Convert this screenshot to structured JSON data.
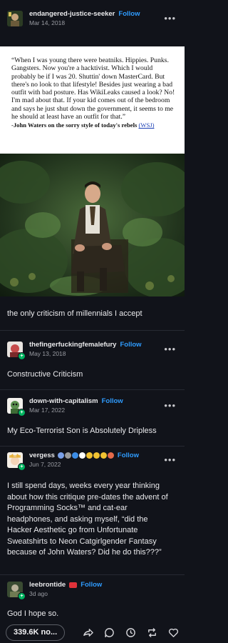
{
  "colors": {
    "background": "#11131a",
    "follow": "#2f9cff",
    "badge_green": "#00b35f"
  },
  "posts": [
    {
      "username": "endangered-justice-seeker",
      "follow": "Follow",
      "date": "Mar 14, 2018"
    },
    {
      "username": "thefingerfuckingfemalefury",
      "follow": "Follow",
      "date": "May 13, 2018",
      "text": "Constructive Criticism"
    },
    {
      "username": "down-with-capitalism",
      "follow": "Follow",
      "date": "Mar 17, 2022",
      "text": "My Eco-Terrorist Son is Absolutely Dripless"
    },
    {
      "username": "vergess",
      "follow": "Follow",
      "date": "Jun 7, 2022",
      "text": "I still spend days, weeks every year thinking about how this critique pre-dates the advent of Programming Socks™ and cat-ear headphones, and asking myself, “did the Hacker Aesthetic go from Unfortunate Sweatshirts to Neon Catgirlgender Fantasy because of John Waters? Did he do this???”"
    },
    {
      "username": "leebrontide",
      "follow": "Follow",
      "date": "3d ago",
      "text": "God I hope so."
    }
  ],
  "quote": {
    "text": "“When I was young there were beatniks. Hippies. Punks. Gangsters. Now you're a hacktivist. Which I would probably be if I was 20. Shuttin' down MasterCard. But there's no look to that lifestyle! Besides just wearing a bad outfit with bad posture. Has WikiLeaks caused a look? No! I'm mad about that. If your kid comes out of the bedroom and says he just shut down the government, it seems to me he should at least have an outfit for that.”",
    "attribution": "-John Waters on the sorry style of today's rebels",
    "source_link": "(WSJ)"
  },
  "caption": "the only criticism of millennials I accept",
  "footer": {
    "notes": "339.6K no...",
    "icons": [
      "share-icon",
      "reply-icon",
      "history-icon",
      "reblog-icon",
      "like-icon"
    ]
  }
}
